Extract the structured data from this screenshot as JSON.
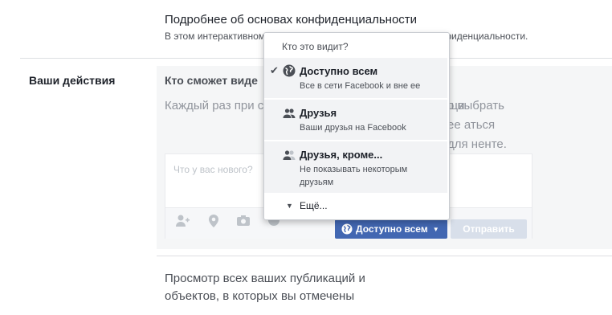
{
  "privacy": {
    "title": "Подробнее об основах конфиденциальности",
    "desc_left": "В этом интерактивном",
    "desc_right": "ие вопросы о конфиденциальности."
  },
  "section": {
    "label": "Ваши действия"
  },
  "panel": {
    "title": "Кто сможет виде",
    "title_tail": "?",
    "text_left": "Каждый раз при с аудиторию, котор новых публикаци",
    "text_right": "о выбрать ее аться для ненте."
  },
  "composer": {
    "placeholder": "Что у вас нового?",
    "audience_label": "Доступно всем",
    "submit_label": "Отправить",
    "tools": [
      "add-friend-icon",
      "location-icon",
      "camera-icon",
      "smile-icon"
    ]
  },
  "dropdown": {
    "header": "Кто это видит?",
    "items": [
      {
        "label": "Доступно всем",
        "sub": "Все в сети Facebook и вне ее",
        "icon": "globe-icon",
        "selected": true
      },
      {
        "label": "Друзья",
        "sub": "Ваши друзья на Facebook",
        "icon": "friends-icon",
        "selected": false
      },
      {
        "label": "Друзья, кроме...",
        "sub": "Не показывать некоторым друзьям",
        "icon": "friends-except-icon",
        "selected": false
      }
    ],
    "more": "Ещё..."
  },
  "bottom": {
    "text": "Просмотр всех ваших публикаций и объектов, в которых вы отмечены"
  },
  "colors": {
    "accent": "#4267b2",
    "panel_bg": "#f5f6f7",
    "submit_disabled": "#d8dfea"
  }
}
